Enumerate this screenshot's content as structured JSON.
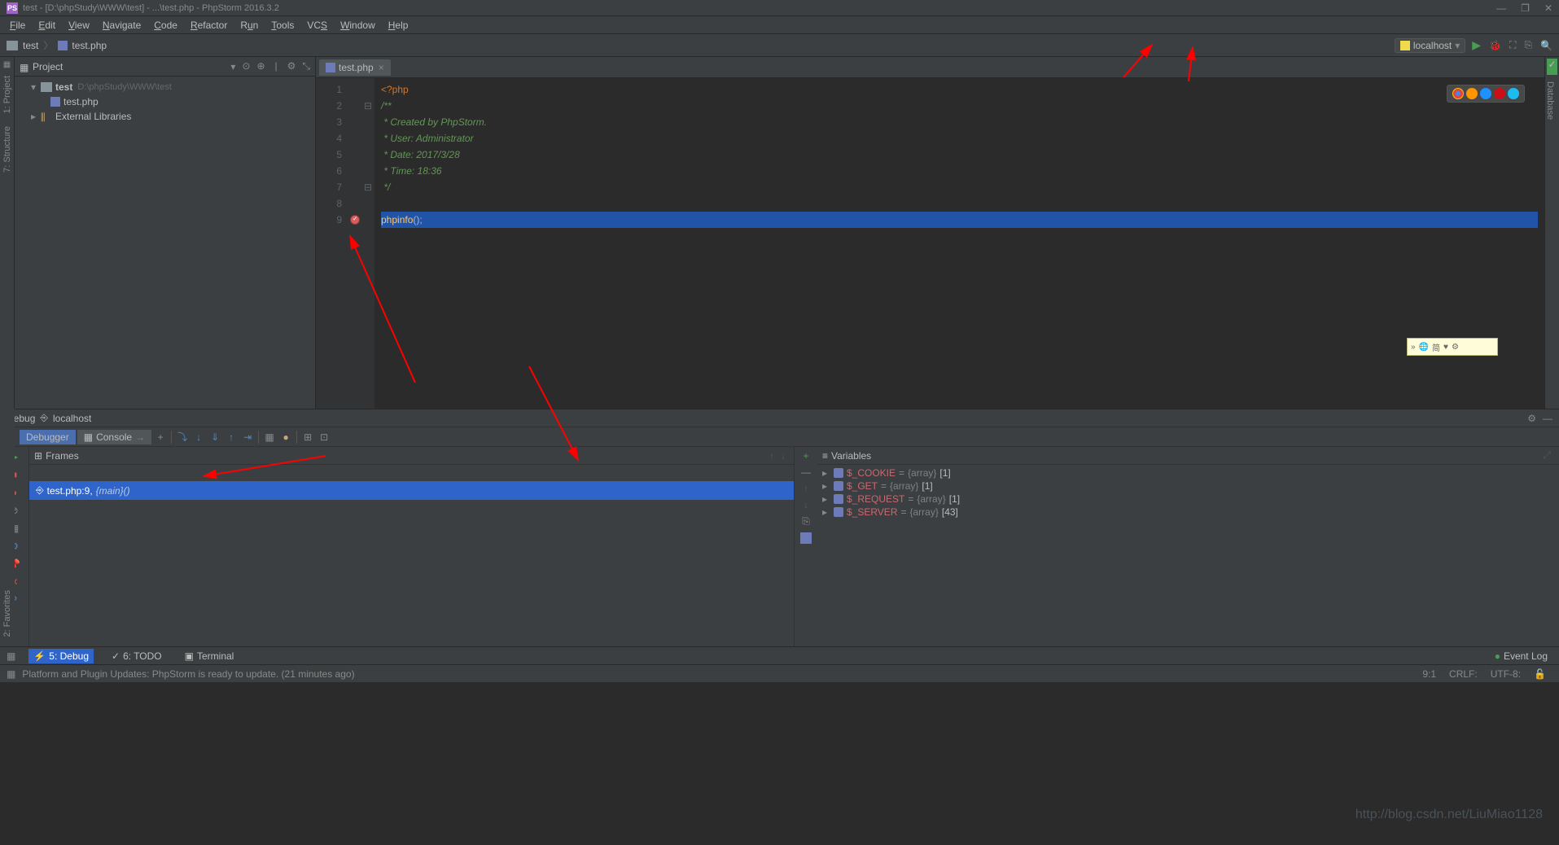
{
  "window": {
    "title": "test - [D:\\phpStudy\\WWW\\test] - ...\\test.php - PhpStorm 2016.3.2",
    "ps": "PS"
  },
  "menu": {
    "file": "File",
    "edit": "Edit",
    "view": "View",
    "navigate": "Navigate",
    "code": "Code",
    "refactor": "Refactor",
    "run": "Run",
    "tools": "Tools",
    "vcs": "VCS",
    "window": "Window",
    "help": "Help"
  },
  "breadcrumb": {
    "project": "test",
    "file": "test.php"
  },
  "runconfig": {
    "label": "localhost",
    "chevron": "▾"
  },
  "project_panel": {
    "title": "Project",
    "root": "test",
    "root_path": "D:\\phpStudy\\WWW\\test",
    "file1": "test.php",
    "libs": "External Libraries"
  },
  "leftbar": {
    "project": "1: Project",
    "structure": "7: Structure",
    "favorites": "2: Favorites"
  },
  "rightbar": {
    "database": "Database"
  },
  "editor": {
    "filename": "test.php",
    "lines": {
      "l1": "1",
      "l2": "2",
      "l3": "3",
      "l4": "4",
      "l5": "5",
      "l6": "6",
      "l7": "7",
      "l8": "8",
      "l9": "9"
    },
    "code": {
      "l1_open": "<?php",
      "l2": "/**",
      "l3": " * Created by PhpStorm.",
      "l4": " * User: Administrator",
      "l5": " * Date: 2017/3/28",
      "l6": " * Time: 18:36",
      "l7": " */",
      "l8": "",
      "l9_func": "phpinfo",
      "l9_rest": "();"
    }
  },
  "debug": {
    "title": "Debug",
    "config": "localhost",
    "tab_debugger": "Debugger",
    "tab_console": "Console",
    "frames_title": "Frames",
    "frame_file": "test.php:9,",
    "frame_method": "{main}()",
    "vars_title": "Variables",
    "vars": [
      {
        "name": "$_COOKIE",
        "eq": "=",
        "type": "{array}",
        "val": "[1]"
      },
      {
        "name": "$_GET",
        "eq": "=",
        "type": "{array}",
        "val": "[1]"
      },
      {
        "name": "$_REQUEST",
        "eq": "=",
        "type": "{array}",
        "val": "[1]"
      },
      {
        "name": "$_SERVER",
        "eq": "=",
        "type": "{array}",
        "val": "[43]"
      }
    ]
  },
  "bottom": {
    "debug": "5: Debug",
    "todo": "6: TODO",
    "terminal": "Terminal",
    "eventlog": "Event Log"
  },
  "status": {
    "msg": "Platform and Plugin Updates: PhpStorm is ready to update. (21 minutes ago)",
    "pos": "9:1",
    "le": "CRLF:",
    "enc": "UTF-8:"
  },
  "watermark": "http://blog.csdn.net/LiuMiao1128"
}
